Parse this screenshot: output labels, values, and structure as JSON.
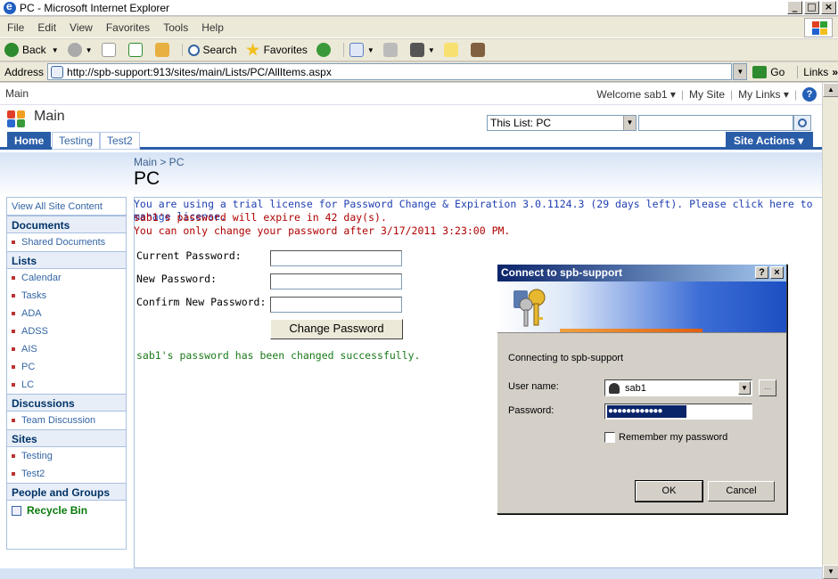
{
  "window": {
    "title": "PC - Microsoft Internet Explorer"
  },
  "menu": [
    "File",
    "Edit",
    "View",
    "Favorites",
    "Tools",
    "Help"
  ],
  "toolbar": {
    "back": "Back",
    "search": "Search",
    "favorites": "Favorites"
  },
  "address": {
    "label": "Address",
    "url": "http://spb-support:913/sites/main/Lists/PC/AllItems.aspx",
    "go": "Go",
    "links": "Links"
  },
  "top": {
    "site": "Main",
    "welcome": "Welcome sab1 ▾",
    "mysite": "My Site",
    "mylinks": "My Links ▾"
  },
  "header": {
    "title": "Main",
    "scope": "This List: PC"
  },
  "tabs": [
    "Home",
    "Testing",
    "Test2"
  ],
  "site_actions": "Site Actions ▾",
  "breadcrumb": "Main > PC",
  "page_title": "PC",
  "quicklaunch": {
    "view_all": "View All Site Content",
    "documents": {
      "head": "Documents",
      "items": [
        "Shared Documents"
      ]
    },
    "lists": {
      "head": "Lists",
      "items": [
        "Calendar",
        "Tasks",
        "ADA",
        "ADSS",
        "AIS",
        "PC",
        "LC"
      ]
    },
    "discussions": {
      "head": "Discussions",
      "items": [
        "Team Discussion"
      ]
    },
    "sites": {
      "head": "Sites",
      "items": [
        "Testing",
        "Test2"
      ]
    },
    "people": "People and Groups",
    "recycle": "Recycle Bin"
  },
  "messages": {
    "license": "You are using a trial license for Password Change & Expiration 3.0.1124.3 (29 days left). Please click here to manage license.",
    "expire": "sab1's password will expire in 42 day(s).",
    "change_after": "You can only change your password after 3/17/2011 3:23:00 PM.",
    "success": "sab1's password has been changed successfully."
  },
  "form": {
    "current": "Current Password:",
    "new": "New Password:",
    "confirm": "Confirm New Password:",
    "button": "Change Password"
  },
  "dialog": {
    "title": "Connect to spb-support",
    "connecting": "Connecting to spb-support",
    "username_label": "User name:",
    "username": "sab1",
    "password_label": "Password:",
    "password_mask": "●●●●●●●●●●●●",
    "remember": "Remember my password",
    "ok": "OK",
    "cancel": "Cancel"
  }
}
